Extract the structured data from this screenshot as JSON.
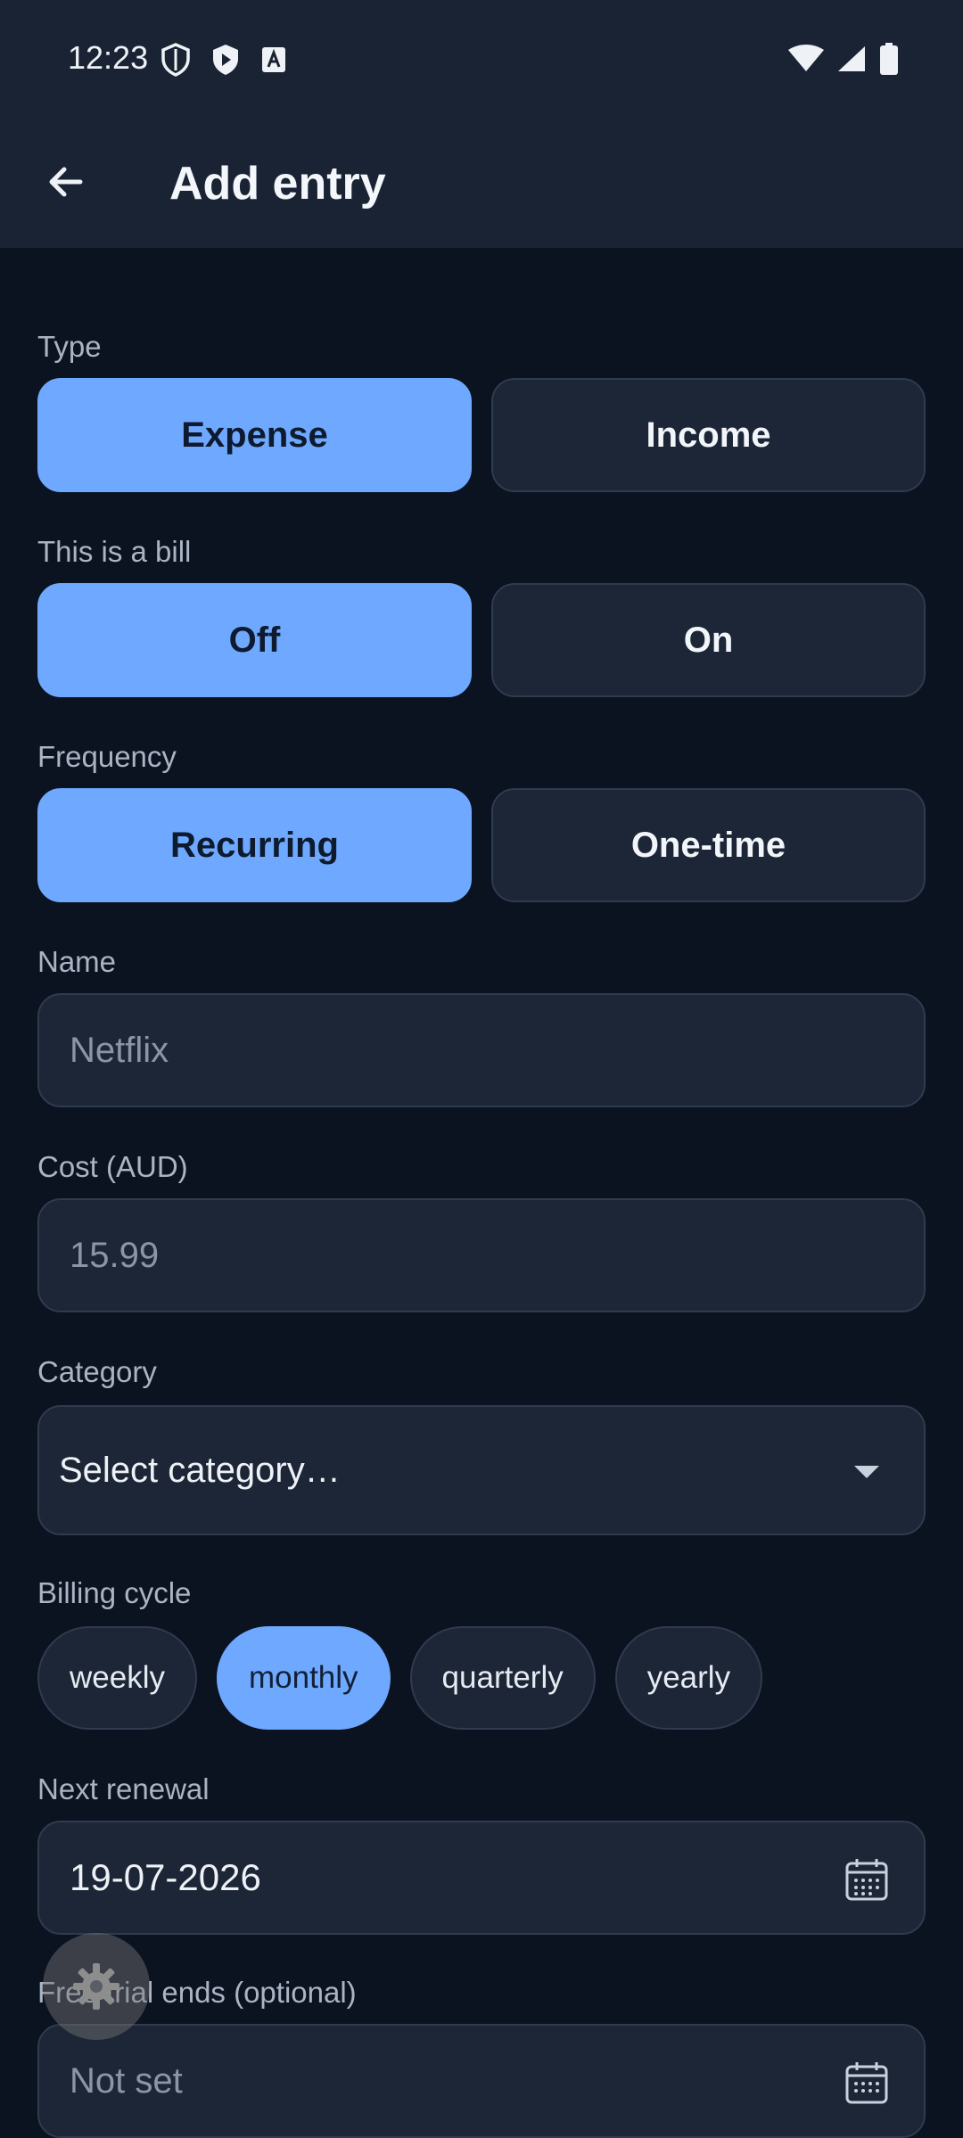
{
  "status_bar": {
    "time": "12:23"
  },
  "app_bar": {
    "title": "Add entry"
  },
  "type": {
    "label": "Type",
    "options": [
      "Expense",
      "Income"
    ],
    "selected": "Expense"
  },
  "bill": {
    "label": "This is a bill",
    "options": [
      "Off",
      "On"
    ],
    "selected": "Off"
  },
  "frequency": {
    "label": "Frequency",
    "options": [
      "Recurring",
      "One-time"
    ],
    "selected": "Recurring"
  },
  "name": {
    "label": "Name",
    "placeholder": "Netflix",
    "value": ""
  },
  "cost": {
    "label": "Cost (AUD)",
    "placeholder": "15.99",
    "value": ""
  },
  "category": {
    "label": "Category",
    "value": "Select category…"
  },
  "billing_cycle": {
    "label": "Billing cycle",
    "options": [
      "weekly",
      "monthly",
      "quarterly",
      "yearly"
    ],
    "selected": "monthly"
  },
  "next_renewal": {
    "label": "Next renewal",
    "value": "19-07-2026"
  },
  "free_trial": {
    "label": "Free trial ends (optional)",
    "value": "Not set"
  },
  "colors": {
    "background": "#0b1220",
    "surface": "#1c2636",
    "accent": "#6ea8ff"
  },
  "icons": {
    "back": "arrow-left-icon",
    "calendar": "calendar-icon",
    "dropdown": "caret-down-icon",
    "settings": "gear-icon"
  }
}
